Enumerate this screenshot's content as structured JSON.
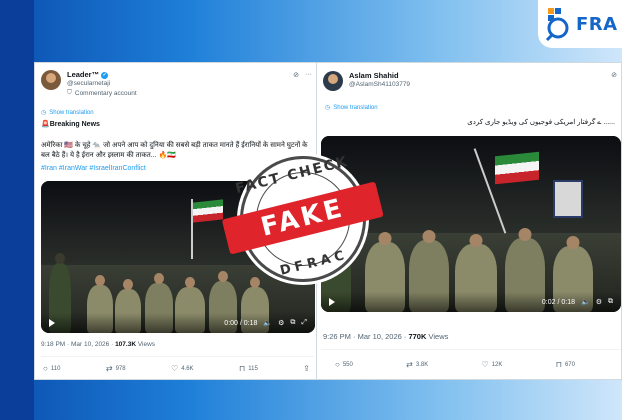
{
  "brand": {
    "name": "FRA"
  },
  "left_post": {
    "author_name": "Leader™",
    "handle": "@secularnetaji",
    "account_type": "Commentary account",
    "show_translation": "Show translation",
    "headline": "🚨Breaking News",
    "body": "अमेरिका 🇺🇸 के चूहे 🐀 जो अपने आप को दुनिया की सबसे बड़ी ताकत मानते हैं ईरानियों के सामने घुटनों के बल बैठे हैं। ये है ईरान और इस्लाम की ताकत... 🔥🇮🇷",
    "hashtags": "#Iran #IranWar #IsraelIranConflict",
    "video_time": "0:00 / 0:18",
    "timestamp": "9:18 PM · Mar 10, 2026 · ",
    "views_count": "107.3K",
    "views_label": " Views",
    "replies": "110",
    "reposts": "978",
    "likes": "4.6K",
    "bookmarks": "115"
  },
  "right_post": {
    "author_name": "Aslam Shahid",
    "handle": "@AslamSh41103779",
    "show_translation": "Show translation",
    "body": "...... ے گرفتار امریکی فوجیوں کی ویڈیو جاری کردی",
    "video_time": "0:02 / 0:18",
    "timestamp": "9:26 PM · Mar 10, 2026 · ",
    "views_count": "770K",
    "views_label": " Views",
    "replies": "550",
    "reposts": "3.8K",
    "likes": "12K",
    "bookmarks": "670"
  },
  "stamp": {
    "top": "FACT CHECK",
    "band": "FAKE",
    "bottom": "DFRAC"
  },
  "colors": {
    "stamp_red": "#e0242b",
    "link_blue": "#1d9bf0",
    "brand_blue": "#1466c9"
  }
}
